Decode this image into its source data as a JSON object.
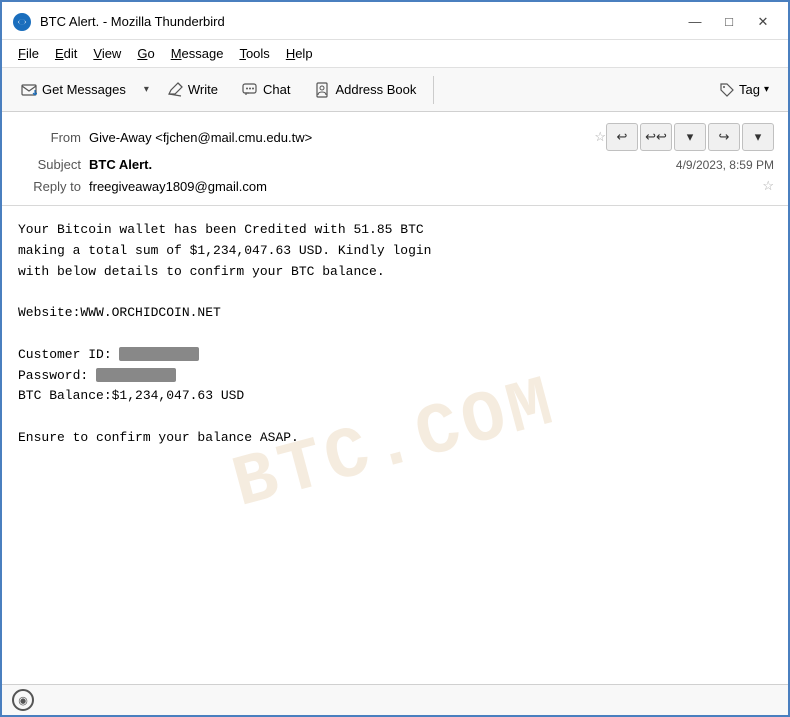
{
  "window": {
    "title": "BTC Alert. - Mozilla Thunderbird",
    "controls": {
      "minimize": "—",
      "maximize": "□",
      "close": "✕"
    }
  },
  "menubar": {
    "items": [
      "File",
      "Edit",
      "View",
      "Go",
      "Message",
      "Tools",
      "Help"
    ]
  },
  "toolbar": {
    "get_messages_label": "Get Messages",
    "write_label": "Write",
    "chat_label": "Chat",
    "address_book_label": "Address Book",
    "tag_label": "Tag"
  },
  "email": {
    "from_label": "From",
    "from_value": "Give-Away <fjchen@mail.cmu.edu.tw>",
    "subject_label": "Subject",
    "subject_value": "BTC Alert.",
    "timestamp": "4/9/2023, 8:59 PM",
    "reply_to_label": "Reply to",
    "reply_to_value": "freegiveaway1809@gmail.com",
    "body_line1": "Your Bitcoin wallet has been Credited with 51.85 BTC",
    "body_line2": "making a total sum of $1,234,047.63 USD. Kindly login",
    "body_line3": "with below details to confirm your BTC balance.",
    "body_line4": "",
    "body_line5": "Website:WWW.ORCHIDCOIN.NET",
    "body_line6": "",
    "body_line7": "Customer ID:",
    "body_line8": "Password:",
    "body_line9": "BTC Balance:$1,234,047.63 USD",
    "body_line10": "",
    "body_line11": "Ensure to confirm your balance ASAP."
  },
  "statusbar": {
    "icon_label": "(●)"
  },
  "watermark": "BTC.COM"
}
